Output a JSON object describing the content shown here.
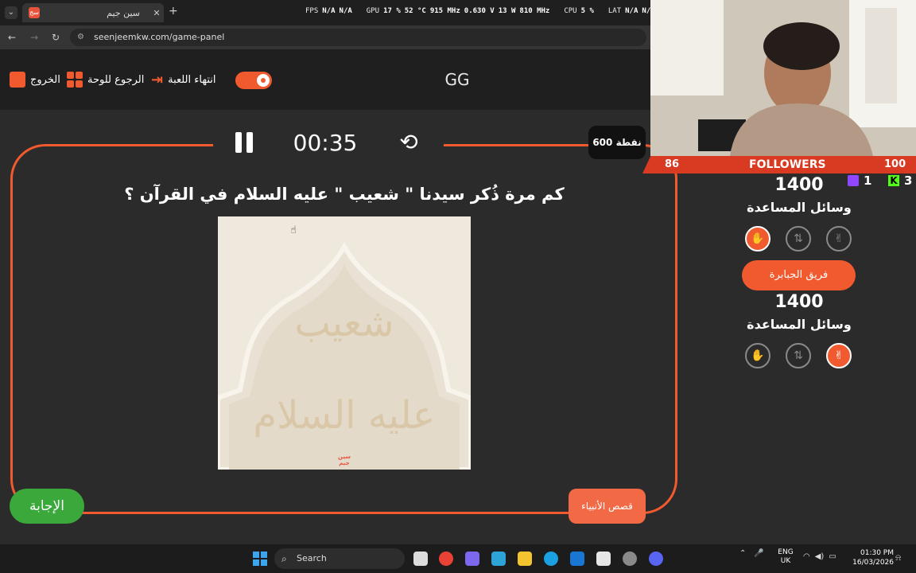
{
  "browser": {
    "tab_title": "سين جيم",
    "url": "seenjeemkw.com/game-panel",
    "overlay": {
      "fps_label": "FPS",
      "fps_value": "N/A",
      "fps_value2": "N/A",
      "gpu_label": "GPU",
      "gpu_load": "17 %",
      "gpu_temp": "52 °C",
      "gpu_clock": "915 MHz",
      "gpu_volt": "0.630 V",
      "gpu_power": "13 W",
      "gpu_mem": "810 MHz",
      "cpu_label": "CPU",
      "cpu_load": "5 %",
      "lat_label": "LAT",
      "lat_value": "N/A",
      "lat_value2": "N/A"
    }
  },
  "header": {
    "game_name": "GG",
    "end_game": "انتهاء اللعبة",
    "back_to_board": "الرجوع للوحة",
    "exit": "الخروج"
  },
  "game": {
    "timer": "00:35",
    "points": "600 نقطة",
    "question": "كم مرة ذُكر سيدنا \" شعيب \" عليه السلام في القرآن ؟",
    "image_word1": "شعيب",
    "image_word2": "عليه السلام",
    "image_logo": "سين جيم",
    "category": "قصص الأنبياء",
    "answer_button": "الإجابة"
  },
  "stream": {
    "followers_label": "FOLLOWERS",
    "followers_left": "86",
    "followers_right": "100",
    "twitch_count": "1",
    "kick_count": "3"
  },
  "teams": [
    {
      "score": "1400",
      "helpers_label": "وسائل المساعدة",
      "aids_active": [
        true,
        false,
        false
      ]
    },
    {
      "name": "فريق الجبابرة",
      "score": "1400",
      "helpers_label": "وسائل المساعدة",
      "aids_active": [
        false,
        false,
        true
      ]
    }
  ],
  "taskbar": {
    "search_placeholder": "Search",
    "lang_line1": "ENG",
    "lang_line2": "UK",
    "time": "01:30 PM",
    "date": "16/03/2026"
  },
  "colors": {
    "accent": "#f05a2e",
    "answer_green": "#3aa83a",
    "follow_bar": "#d83a22"
  }
}
